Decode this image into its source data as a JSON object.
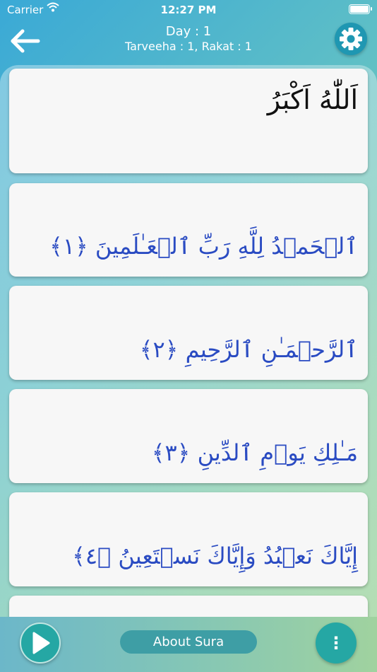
{
  "status_bar": {
    "carrier": "Carrier",
    "time": "12:27 PM",
    "wifi_icon": "wifi-icon",
    "battery_icon": "battery-icon"
  },
  "header": {
    "day": "Day : 1",
    "subtitle": "Tarveeha : 1, Rakat : 1",
    "back_icon": "arrow-left-icon",
    "settings_icon": "gear-icon"
  },
  "cards": [
    {
      "text": "اَللّٰهُ اَكْبَرُ"
    },
    {
      "text": "ٱلۡحَمۡدُ لِلَّهِ رَبِّ ٱلۡعَـٰلَمِينَ ﴿١﴾"
    },
    {
      "text": "ٱلرَّحۡمَـٰنِ ٱلرَّحِيمِ ﴿٢﴾"
    },
    {
      "text": "مَـٰلِكِ يَوۡمِ ٱلدِّينِ ﴿٣﴾"
    },
    {
      "text": "إِيَّاكَ نَعۡبُدُ وَإِيَّاكَ نَسۡتَعِينُ ﴿٤﴾"
    },
    {
      "text": ""
    }
  ],
  "bottom_bar": {
    "play_icon": "play-icon",
    "about_label": "About Sura",
    "more_label": "⋮"
  },
  "colors": {
    "verse_text": "#2a4bc2",
    "accent_button": "#25a7a4",
    "settings_button": "#1f97b2"
  }
}
